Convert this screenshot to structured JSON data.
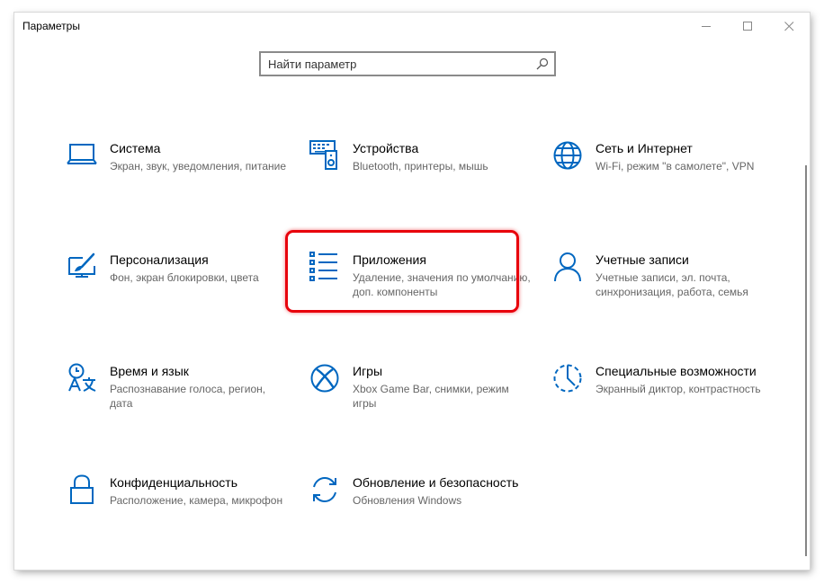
{
  "window": {
    "title": "Параметры",
    "accent_color": "#0067c0",
    "highlight_color": "#e8000b"
  },
  "search": {
    "placeholder": "Найти параметр",
    "icon": "search-icon"
  },
  "tiles": [
    {
      "title": "Система",
      "desc": "Экран, звук, уведомления, питание",
      "icon": "laptop-icon"
    },
    {
      "title": "Устройства",
      "desc": "Bluetooth, принтеры, мышь",
      "icon": "devices-icon"
    },
    {
      "title": "Сеть и Интернет",
      "desc": "Wi-Fi, режим \"в самолете\", VPN",
      "icon": "globe-icon"
    },
    {
      "title": "Персонализация",
      "desc": "Фон, экран блокировки, цвета",
      "icon": "personalization-icon"
    },
    {
      "title": "Приложения",
      "desc": "Удаление, значения по умолчанию, доп. компоненты",
      "icon": "apps-list-icon"
    },
    {
      "title": "Учетные записи",
      "desc": "Учетные записи, эл. почта, синхронизация, работа, семья",
      "icon": "person-icon"
    },
    {
      "title": "Время и язык",
      "desc": "Распознавание голоса, регион, дата",
      "icon": "time-language-icon"
    },
    {
      "title": "Игры",
      "desc": "Xbox Game Bar, снимки, режим игры",
      "icon": "xbox-icon"
    },
    {
      "title": "Специальные возможности",
      "desc": "Экранный диктор, контрастность",
      "icon": "accessibility-icon"
    },
    {
      "title": "Конфиденциальность",
      "desc": "Расположение, камера, микрофон",
      "icon": "lock-icon"
    },
    {
      "title": "Обновление и безопасность",
      "desc": "Обновления Windows",
      "icon": "update-sync-icon"
    }
  ]
}
